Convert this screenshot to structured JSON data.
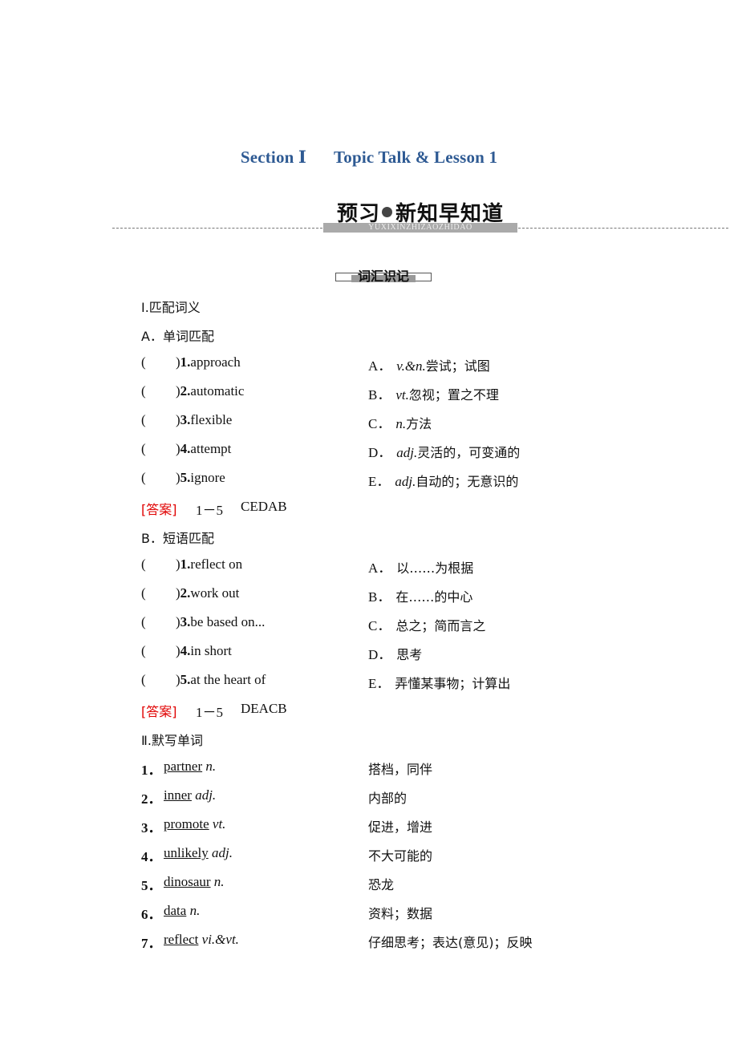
{
  "title": {
    "section": "Section Ⅰ",
    "lesson": "Topic Talk & Lesson 1"
  },
  "banner": {
    "label_bold": "预习",
    "label_rest": "新知早知道",
    "pinyin": "YUXIXINZHIZAOZHIDAO"
  },
  "vocab_tag": "词汇识记",
  "part1": {
    "heading": "Ⅰ.匹配词义",
    "A": {
      "heading": "A．单词匹配",
      "items": [
        {
          "num": "1.",
          "term": "approach"
        },
        {
          "num": "2.",
          "term": "automatic"
        },
        {
          "num": "3.",
          "term": "flexible"
        },
        {
          "num": "4.",
          "term": "attempt"
        },
        {
          "num": "5.",
          "term": "ignore"
        }
      ],
      "options": [
        {
          "letter": "A．",
          "pos": "v.&n.",
          "meaning": "尝试；试图"
        },
        {
          "letter": "B．",
          "pos": "vt.",
          "meaning": "忽视；置之不理"
        },
        {
          "letter": "C．",
          "pos": "n.",
          "meaning": "方法"
        },
        {
          "letter": "D．",
          "pos": "adj.",
          "meaning": "灵活的，可变通的"
        },
        {
          "letter": "E．",
          "pos": "adj.",
          "meaning": "自动的；无意识的"
        }
      ],
      "answer_label": "[答案]",
      "answer_range": "1－5",
      "answer": "CEDAB"
    },
    "B": {
      "heading": "B．短语匹配",
      "items": [
        {
          "num": "1.",
          "term": "reflect on"
        },
        {
          "num": "2.",
          "term": "work out"
        },
        {
          "num": "3.",
          "term": "be based on..."
        },
        {
          "num": "4.",
          "term": "in short"
        },
        {
          "num": "5.",
          "term": "at the heart of"
        }
      ],
      "options": [
        {
          "letter": "A．",
          "meaning": "以……为根据"
        },
        {
          "letter": "B．",
          "meaning": "在……的中心"
        },
        {
          "letter": "C．",
          "meaning": "总之；简而言之"
        },
        {
          "letter": "D．",
          "meaning": "思考"
        },
        {
          "letter": "E．",
          "meaning": "弄懂某事物；计算出"
        }
      ],
      "answer_label": "[答案]",
      "answer_range": "1－5",
      "answer": "DEACB"
    }
  },
  "part2": {
    "heading": "Ⅱ.默写单词",
    "items": [
      {
        "num": "1．",
        "word": "partner",
        "pos": "n.",
        "meaning": "搭档，同伴"
      },
      {
        "num": "2．",
        "word": "inner",
        "pos": "adj.",
        "meaning": "内部的"
      },
      {
        "num": "3．",
        "word": "promote",
        "pos": "vt.",
        "meaning": "促进，增进"
      },
      {
        "num": "4．",
        "word": "unlikely",
        "pos": "adj.",
        "meaning": "不大可能的"
      },
      {
        "num": "5．",
        "word": "dinosaur",
        "pos": "n.",
        "meaning": "恐龙"
      },
      {
        "num": "6．",
        "word": "data",
        "pos": "n.",
        "meaning": "资料；数据"
      },
      {
        "num": "7．",
        "word": "reflect",
        "pos": "vi.&vt.",
        "meaning": "仔细思考；表达(意见)；反映"
      }
    ]
  }
}
